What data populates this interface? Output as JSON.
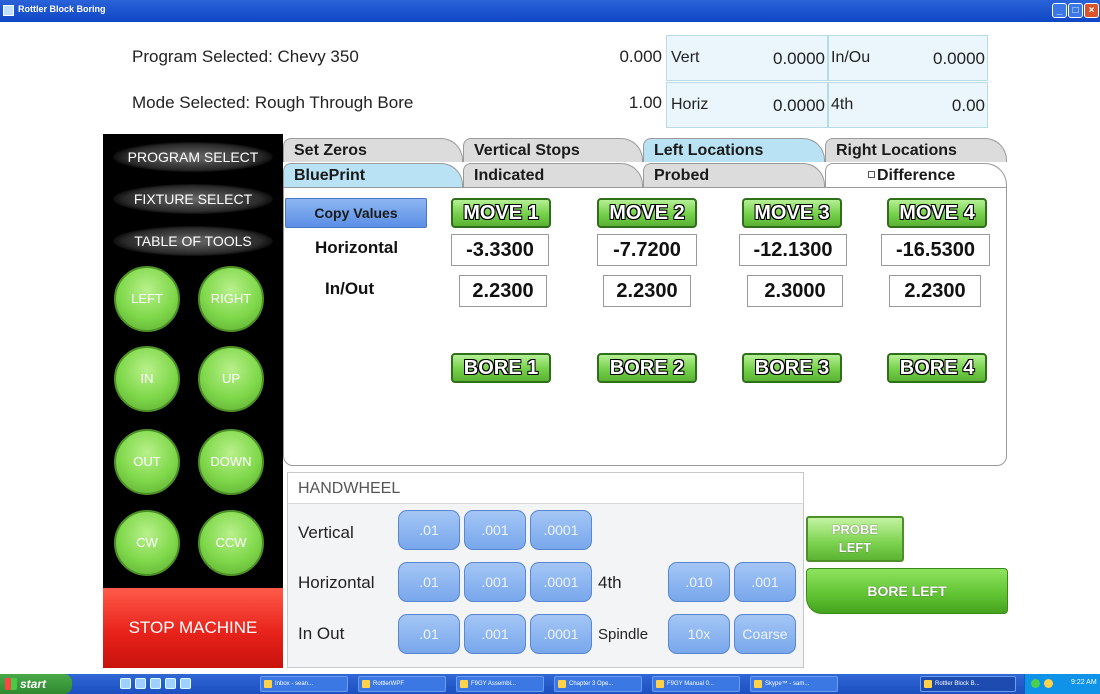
{
  "window": {
    "title": "Rottler Block Boring"
  },
  "header": {
    "program_label": "Program Selected: Chevy 350",
    "mode_label": "Mode Selected: Rough Through Bore",
    "value_top": "0.000",
    "value_bottom": "1.00",
    "readouts": {
      "vert_label": "Vert",
      "vert_value": "0.0000",
      "inout_label": "In/Ou",
      "inout_value": "0.0000",
      "horiz_label": "Horiz",
      "horiz_value": "0.0000",
      "fourth_label": "4th",
      "fourth_value": "0.00"
    }
  },
  "sidebar": {
    "menu": [
      "PROGRAM SELECT",
      "FIXTURE SELECT",
      "TABLE OF TOOLS"
    ],
    "jog": [
      "LEFT",
      "RIGHT",
      "IN",
      "UP",
      "OUT",
      "DOWN",
      "CW",
      "CCW"
    ],
    "stop_label": "STOP MACHINE"
  },
  "tabs": {
    "row1": [
      "Set Zeros",
      "Vertical Stops",
      "Left Locations",
      "Right Locations"
    ],
    "row2": [
      "BluePrint",
      "Indicated",
      "Probed",
      "Difference"
    ],
    "active_row1": "Left Locations",
    "active_row2": "BluePrint"
  },
  "main": {
    "copy_values_label": "Copy Values",
    "horizontal_label": "Horizontal",
    "inout_label": "In/Out",
    "moves": [
      "MOVE 1",
      "MOVE 2",
      "MOVE 3",
      "MOVE 4"
    ],
    "horizontal_values": [
      "-3.3300",
      "-7.7200",
      "-12.1300",
      "-16.5300"
    ],
    "inout_values": [
      "2.2300",
      "2.2300",
      "2.3000",
      "2.2300"
    ],
    "bores": [
      "BORE 1",
      "BORE 2",
      "BORE 3",
      "BORE 4"
    ]
  },
  "handwheel": {
    "title": "HANDWHEEL",
    "vertical_label": "Vertical",
    "horizontal_label": "Horizontal",
    "inout_label": "In Out",
    "fourth_label": "4th",
    "spindle_label": "Spindle",
    "increments": [
      ".01",
      ".001",
      ".0001"
    ],
    "fourth_increments": [
      ".010",
      ".001"
    ],
    "spindle_options": [
      "10x",
      "Coarse"
    ]
  },
  "actions": {
    "probe_left_label_1": "PROBE",
    "probe_left_label_2": "LEFT",
    "bore_left_label": "BORE LEFT"
  },
  "taskbar": {
    "start_label": "start",
    "items": [
      "Inbox - sean...",
      "RottlerWPF",
      "F9GY Assembl...",
      "Chapter 3 Ope...",
      "F9GY Manual 0...",
      "Skype™ - sam...",
      "Rottler Block B..."
    ],
    "clock": "9:22 AM"
  },
  "colors": {
    "accent_green": "#75d04a",
    "stop_red": "#e8231b",
    "tab_active": "#b9e2f5",
    "hw_button": "#78a7ec",
    "titlebar": "#0f46c4"
  }
}
